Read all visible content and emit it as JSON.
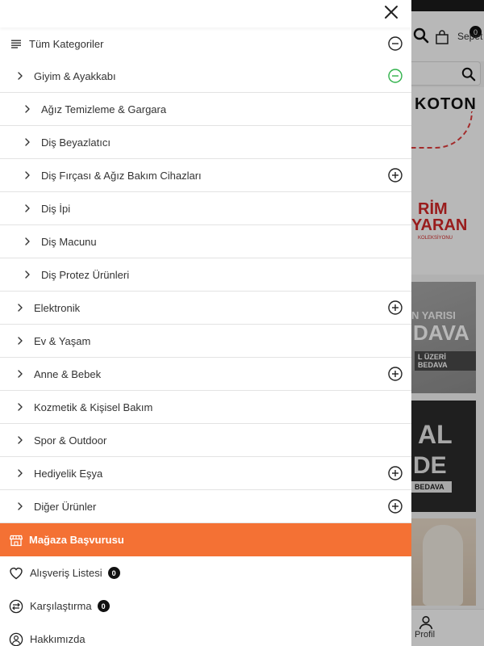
{
  "background": {
    "cart_count": "0",
    "cart_label": "Sepet",
    "brand": "KOTON",
    "promo_red_line1": "RİM",
    "promo_red_line2": "YARAN",
    "promo_small": "KOLEKSİYONU",
    "promo2_line1": "N YARISI",
    "promo2_line2": "DAVA",
    "promo2_line3": "L ÜZERİ BEDAVA",
    "promo3_line1": "AL",
    "promo3_line2": "DE",
    "promo3_line3": "BEDAVA",
    "bottomnav_profile": "Profil"
  },
  "drawer": {
    "header": {
      "all_categories": "Tüm Kategoriler"
    },
    "categories": [
      {
        "label": "Giyim & Ayakkabı",
        "level": 1,
        "toggle": "minus-active"
      },
      {
        "label": "Ağız Temizleme & Gargara",
        "level": 2,
        "toggle": "none"
      },
      {
        "label": "Diş Beyazlatıcı",
        "level": 2,
        "toggle": "none"
      },
      {
        "label": "Diş Fırçası & Ağız Bakım Cihazları",
        "level": 2,
        "toggle": "plus"
      },
      {
        "label": "Diş İpi",
        "level": 2,
        "toggle": "none"
      },
      {
        "label": "Diş Macunu",
        "level": 2,
        "toggle": "none"
      },
      {
        "label": "Diş Protez Ürünleri",
        "level": 2,
        "toggle": "none"
      },
      {
        "label": "Elektronik",
        "level": 1,
        "toggle": "plus"
      },
      {
        "label": "Ev & Yaşam",
        "level": 1,
        "toggle": "none"
      },
      {
        "label": "Anne & Bebek",
        "level": 1,
        "toggle": "plus"
      },
      {
        "label": "Kozmetik & Kişisel Bakım",
        "level": 1,
        "toggle": "none"
      },
      {
        "label": "Spor & Outdoor",
        "level": 1,
        "toggle": "none"
      },
      {
        "label": "Hediyelik Eşya",
        "level": 1,
        "toggle": "plus"
      },
      {
        "label": "Diğer Ürünler",
        "level": 1,
        "toggle": "plus"
      }
    ],
    "store_application": "Mağaza Başvurusu",
    "wishlist": {
      "label": "Alışveriş Listesi",
      "count": "0"
    },
    "compare": {
      "label": "Karşılaştırma",
      "count": "0"
    },
    "about": "Hakkımızda"
  },
  "colors": {
    "accent_orange": "#f47134",
    "active_green": "#2fb14a"
  }
}
